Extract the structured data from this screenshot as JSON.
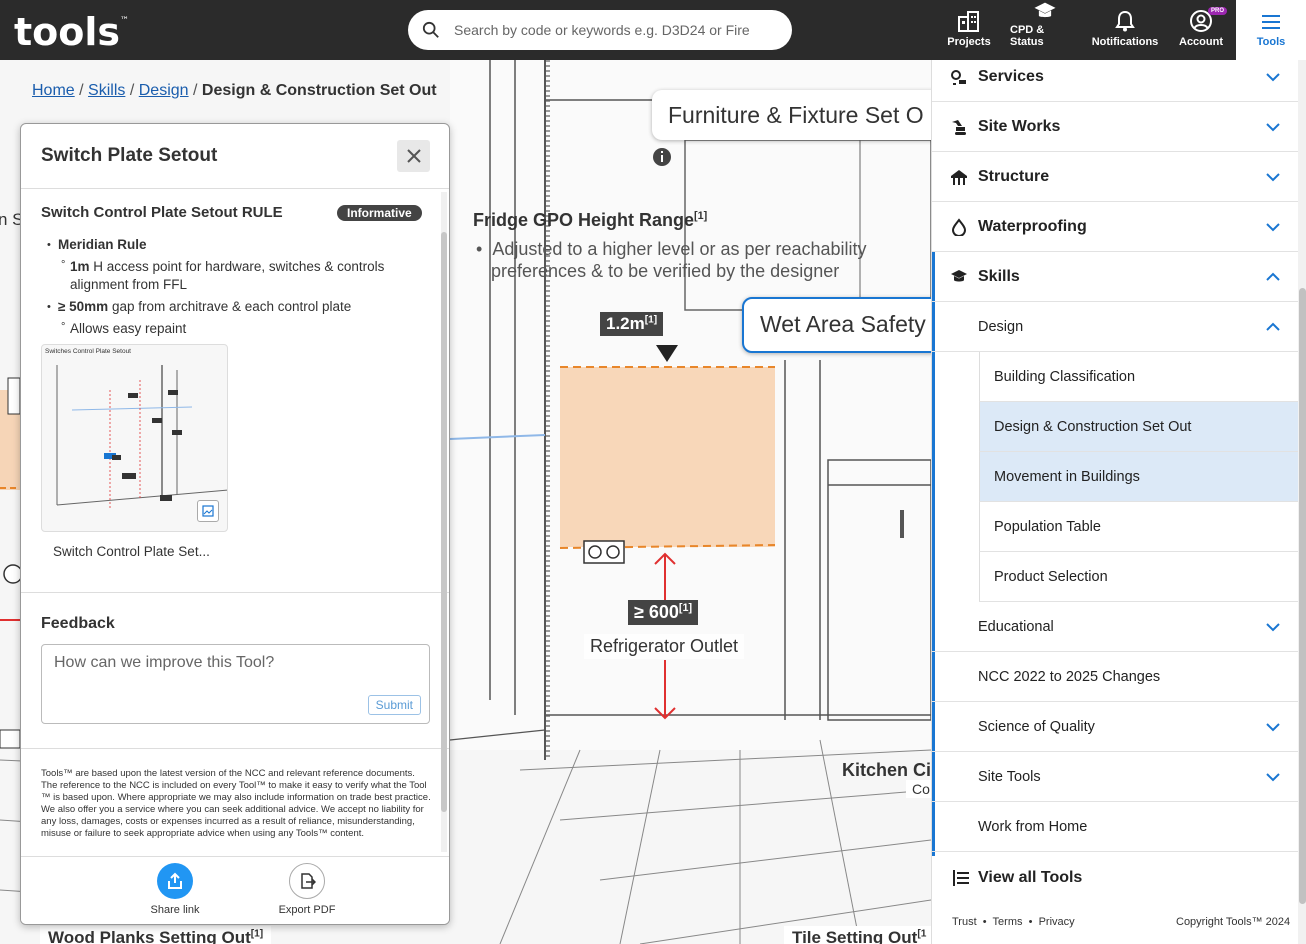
{
  "header": {
    "logo": "tools",
    "logo_tm": "™",
    "search_placeholder": "Search by code or keywords e.g. D3D24 or Fire",
    "nav": [
      {
        "label": "Projects",
        "icon": "buildings-icon"
      },
      {
        "label": "CPD & Status",
        "icon": "graduation-cap-icon"
      },
      {
        "label": "Notifications",
        "icon": "bell-icon"
      },
      {
        "label": "Account",
        "icon": "account-icon",
        "badge": "PRO"
      },
      {
        "label": "Tools",
        "icon": "menu-icon"
      }
    ]
  },
  "breadcrumb": {
    "items": [
      "Home",
      "Skills",
      "Design"
    ],
    "current": "Design & Construction Set Out",
    "separator": "/"
  },
  "scene": {
    "furniture_callout": "Furniture & Fixture Set O",
    "wet_area_callout": "Wet Area Safety",
    "fridge_title": "Fridge GPO Height Range",
    "fridge_ref": "[1]",
    "fridge_bullet_line1": "Adjusted to a higher level or as per reachability",
    "fridge_bullet_line2": "preferences & to be verified by the designer",
    "height_tag": "1.2m",
    "height_ref": "[1]",
    "gap_tag": "≥ 600",
    "gap_ref": "[1]",
    "outlet_label": "Refrigerator Outlet",
    "kitchen_label": "Kitchen Ci",
    "kitchen_sub": "Co",
    "wood_label": "Wood Planks Setting Out",
    "wood_ref": "[1]",
    "tile_label": "Tile Setting Out",
    "tile_ref": "[1",
    "left_partial": "n S"
  },
  "panel": {
    "title": "Switch Plate Setout",
    "rule_title": "Switch Control Plate Setout RULE",
    "badge": "Informative",
    "rules": {
      "r1": "Meridian Rule",
      "r1a_bold": "1m",
      "r1a_text": " H access point for hardware, switches & controls alignment from FFL",
      "r2_bold": "≥ 50mm",
      "r2_text": " gap from architrave & each control plate",
      "r2a": "Allows easy repaint"
    },
    "thumbnail_title": "Switches Control Plate Setout",
    "thumbnail_caption": "Switch Control Plate Set...",
    "feedback_label": "Feedback",
    "feedback_placeholder": "How can we improve this Tool?",
    "submit_label": "Submit",
    "disclaimer": "Tools™  are based upon the latest version of the NCC and relevant reference documents. The reference to the NCC is included on every Tool™  to make it easy to verify what the Tool ™  is based upon. Where appropriate we may also include information on trade best practice. We also offer you a service where you can seek additional advice. We accept no liability for any loss, damages, costs or expenses incurred as a result of reliance, misunderstanding, misuse or failure to seek appropriate advice when using any Tools™  content.",
    "share_label": "Share link",
    "export_label": "Export PDF"
  },
  "sidebar": {
    "services": "Services",
    "site_works": "Site Works",
    "structure": "Structure",
    "waterproofing": "Waterproofing",
    "skills": "Skills",
    "design": "Design",
    "design_items": [
      "Building Classification",
      "Design & Construction Set Out",
      "Movement in Buildings",
      "Population Table",
      "Product Selection"
    ],
    "educational": "Educational",
    "ncc_changes": "NCC 2022 to 2025 Changes",
    "science_quality": "Science of Quality",
    "site_tools": "Site Tools",
    "work_from_home": "Work from Home",
    "view_all": "View all Tools",
    "footer_links": [
      "Trust",
      "Terms",
      "Privacy"
    ],
    "copyright": "Copyright Tools™ 2024"
  },
  "colors": {
    "header_bg": "#2b2b2b",
    "accent": "#1976d2",
    "highlight_row": "#dce9f7",
    "share_button": "#2196f3",
    "badge_pro": "#9c27b0",
    "orange_zone": "#f7c79d",
    "dimension_red": "#e03030"
  }
}
